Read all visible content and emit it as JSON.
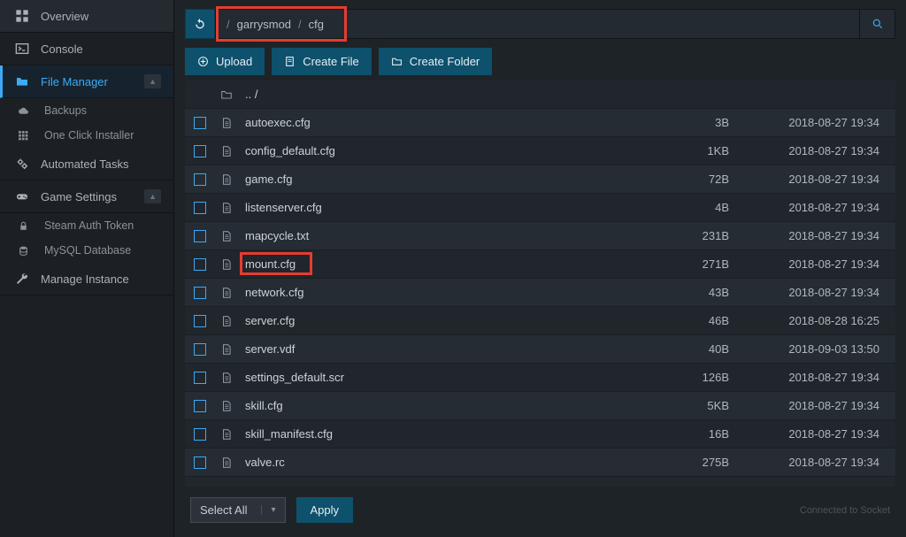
{
  "sidebar": {
    "items": [
      {
        "label": "Overview",
        "icon": "grid",
        "active": false,
        "hasChildren": false
      },
      {
        "label": "Console",
        "icon": "terminal",
        "active": false,
        "hasChildren": false
      },
      {
        "label": "File Manager",
        "icon": "folder",
        "active": true,
        "hasChildren": true,
        "children": [
          {
            "label": "Backups",
            "icon": "cloud"
          },
          {
            "label": "One Click Installer",
            "icon": "grid-small"
          }
        ]
      },
      {
        "label": "Automated Tasks",
        "icon": "gears",
        "active": false,
        "hasChildren": false
      },
      {
        "label": "Game Settings",
        "icon": "gamepad",
        "active": false,
        "hasChildren": true,
        "children": [
          {
            "label": "Steam Auth Token",
            "icon": "lock"
          },
          {
            "label": "MySQL Database",
            "icon": "database"
          }
        ]
      },
      {
        "label": "Manage Instance",
        "icon": "wrench",
        "active": false,
        "hasChildren": false
      }
    ]
  },
  "breadcrumb": {
    "segments": [
      "garrysmod",
      "cfg"
    ]
  },
  "toolbar": {
    "upload_label": "Upload",
    "create_file_label": "Create File",
    "create_folder_label": "Create Folder"
  },
  "up_label": ".. /",
  "files": [
    {
      "name": "autoexec.cfg",
      "size": "3B",
      "date": "2018-08-27 19:34",
      "hl": false
    },
    {
      "name": "config_default.cfg",
      "size": "1KB",
      "date": "2018-08-27 19:34",
      "hl": false
    },
    {
      "name": "game.cfg",
      "size": "72B",
      "date": "2018-08-27 19:34",
      "hl": false
    },
    {
      "name": "listenserver.cfg",
      "size": "4B",
      "date": "2018-08-27 19:34",
      "hl": false
    },
    {
      "name": "mapcycle.txt",
      "size": "231B",
      "date": "2018-08-27 19:34",
      "hl": false
    },
    {
      "name": "mount.cfg",
      "size": "271B",
      "date": "2018-08-27 19:34",
      "hl": true
    },
    {
      "name": "network.cfg",
      "size": "43B",
      "date": "2018-08-27 19:34",
      "hl": false
    },
    {
      "name": "server.cfg",
      "size": "46B",
      "date": "2018-08-28 16:25",
      "hl": false
    },
    {
      "name": "server.vdf",
      "size": "40B",
      "date": "2018-09-03 13:50",
      "hl": false
    },
    {
      "name": "settings_default.scr",
      "size": "126B",
      "date": "2018-08-27 19:34",
      "hl": false
    },
    {
      "name": "skill.cfg",
      "size": "5KB",
      "date": "2018-08-27 19:34",
      "hl": false
    },
    {
      "name": "skill_manifest.cfg",
      "size": "16B",
      "date": "2018-08-27 19:34",
      "hl": false
    },
    {
      "name": "valve.rc",
      "size": "275B",
      "date": "2018-08-27 19:34",
      "hl": false
    }
  ],
  "footer": {
    "select_all_label": "Select All",
    "apply_label": "Apply",
    "socket_label": "Connected to Socket"
  }
}
